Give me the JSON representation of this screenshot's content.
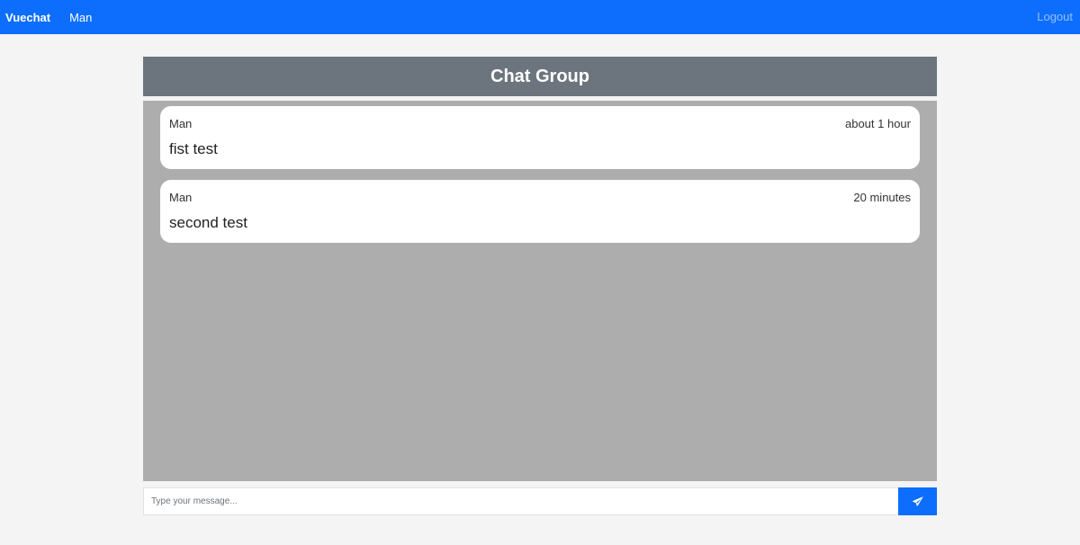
{
  "navbar": {
    "brand": "Vuechat",
    "user": "Man",
    "logout": "Logout"
  },
  "chat": {
    "title": "Chat Group",
    "messages": [
      {
        "author": "Man",
        "time": "about 1 hour",
        "text": "fist test"
      },
      {
        "author": "Man",
        "time": "20 minutes",
        "text": "second test"
      }
    ]
  },
  "composer": {
    "value": "",
    "placeholder": "Type your message...",
    "send_icon": "paper-plane-icon"
  },
  "colors": {
    "primary": "#0d6efd",
    "header": "#6c757d",
    "chat_background": "#adadad",
    "page_background": "#f4f4f4"
  }
}
